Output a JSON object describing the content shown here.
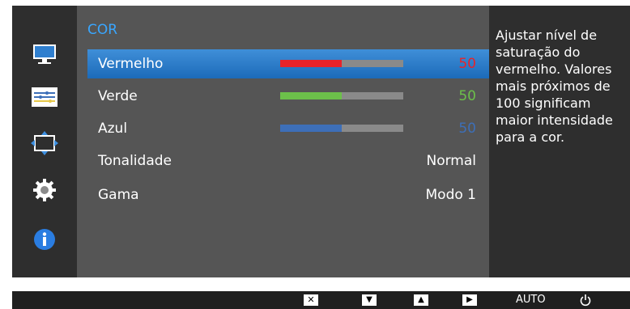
{
  "menu": {
    "title": "COR",
    "items": [
      {
        "label": "Vermelho",
        "value": "50",
        "level": 0.5,
        "color": "#e8232a",
        "value_color": "#e8232a",
        "selected": true
      },
      {
        "label": "Verde",
        "value": "50",
        "level": 0.5,
        "color": "#6cc04a",
        "value_color": "#6cc04a",
        "selected": false
      },
      {
        "label": "Azul",
        "value": "50",
        "level": 0.5,
        "color": "#3d6fb8",
        "value_color": "#3d6fb8",
        "selected": false
      },
      {
        "label": "Tonalidade",
        "value": "Normal",
        "value_color": "#ffffff",
        "selected": false
      },
      {
        "label": "Gama",
        "value": "Modo 1",
        "value_color": "#ffffff",
        "selected": false
      }
    ]
  },
  "help_text": "Ajustar nível de saturação do vermelho. Valores mais próximos de 100 significam maior intensidade para a cor.",
  "left_icons": [
    "monitor-icon",
    "picture-settings-icon",
    "position-resize-icon",
    "gear-icon",
    "info-icon"
  ],
  "bottom_buttons": {
    "close": "✕",
    "down": "▼",
    "up": "▲",
    "enter": "▶",
    "auto": "AUTO",
    "power": "power-icon"
  },
  "colors": {
    "accent": "#39a6ff",
    "selected_row": "#1c6bb9",
    "bar_track": "#8a8a8a"
  }
}
